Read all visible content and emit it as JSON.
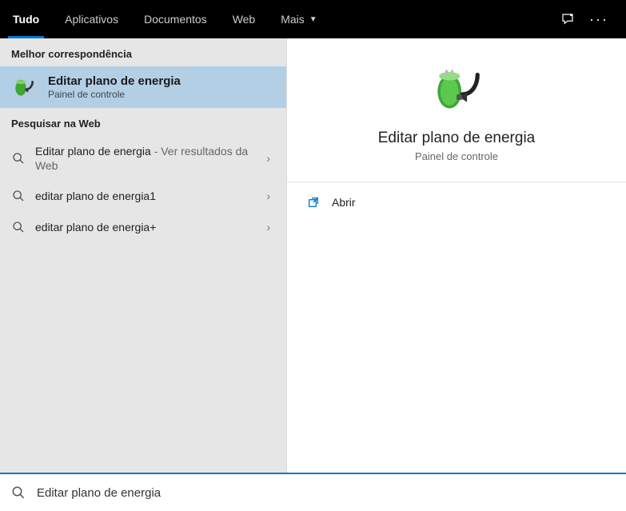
{
  "tabs": {
    "all": "Tudo",
    "apps": "Aplicativos",
    "docs": "Documentos",
    "web": "Web",
    "more": "Mais"
  },
  "sections": {
    "best_match": "Melhor correspondência",
    "search_web": "Pesquisar na Web"
  },
  "best_match": {
    "title": "Editar plano de energia",
    "subtitle": "Painel de controle"
  },
  "web_results": [
    {
      "text": "Editar plano de energia",
      "suffix": " - Ver resultados da Web"
    },
    {
      "text": "editar plano de energia1",
      "suffix": ""
    },
    {
      "text": "editar plano de energia+",
      "suffix": ""
    }
  ],
  "preview": {
    "title": "Editar plano de energia",
    "subtitle": "Painel de controle"
  },
  "actions": {
    "open": "Abrir"
  },
  "search": {
    "value": "Editar plano de energia"
  }
}
